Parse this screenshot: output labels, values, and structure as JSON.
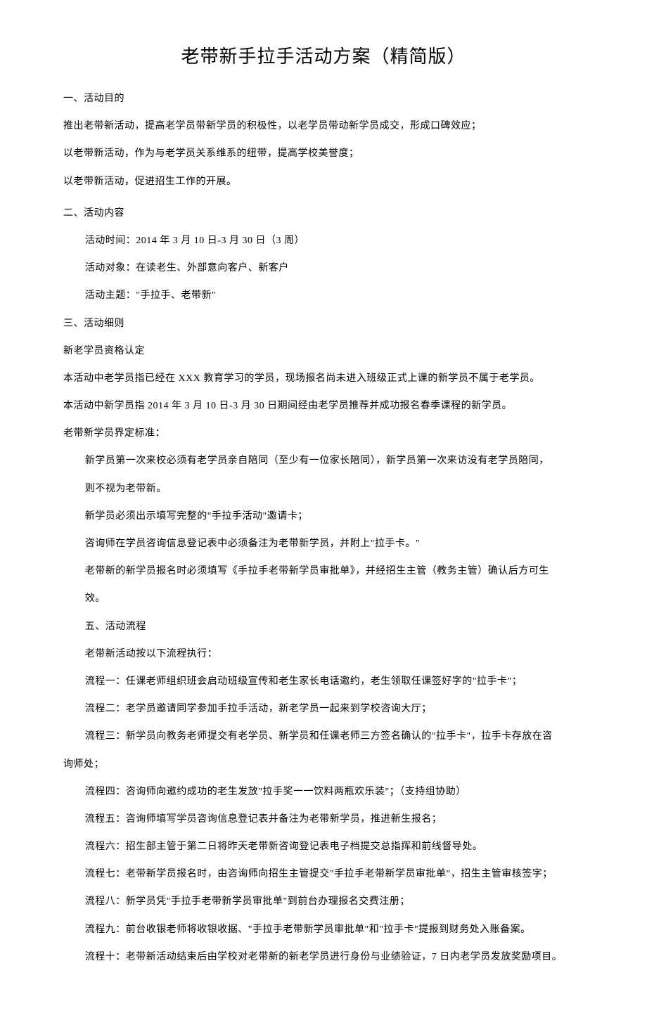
{
  "title": "老带新手拉手活动方案（精简版）",
  "section1": {
    "heading": "一、活动目的",
    "p1": "推出老带新活动，提高老学员带新学员的积极性，以老学员带动新学员成交，形成口碑效应；",
    "p2": "以老带新活动，作为与老学员关系维系的纽带，提高学校美誉度；",
    "p3": "以老带新活动，促进招生工作的开展。"
  },
  "section2": {
    "heading": "二、活动内容",
    "p1": "活动时间：2014 年 3 月 10 日-3 月 30 日（3 周）",
    "p2": "活动对象：在读老生、外部意向客户、新客户",
    "p3": "活动主题：\"手拉手、老带新\""
  },
  "section3": {
    "heading": "三、活动细则",
    "p1": "新老学员资格认定",
    "p2": "本活动中老学员指已经在 XXX 教育学习的学员，现场报名尚未进入班级正式上课的新学员不属于老学员。",
    "p3": "本活动中新学员指 2014 年 3 月 10 日-3 月 30 日期间经由老学员推荐并成功报名春季课程的新学员。",
    "p4": "老带新学员界定标准：",
    "p5a": "新学员第一次来校必须有老学员亲自陪同（至少有一位家长陪同），新学员第一次来访没有老学员陪同，",
    "p5b": "则不视为老带新。",
    "p6": "新学员必须出示填写完整的\"手拉手活动\"邀请卡；",
    "p7": "咨询师在学员咨询信息登记表中必须备注为老带新学员，并附上\"拉手卡。\"",
    "p8a": "老带新的新学员报名时必须填写《手拉手老带新学员审批单》，并经招生主管（教务主管）确认后方可生",
    "p8b": "效。"
  },
  "section5": {
    "heading": "五、活动流程",
    "intro": "老带新活动按以下流程执行：",
    "f1": "流程一：任课老师组织班会启动班级宣传和老生家长电话邀约，老生领取任课签好字的\"拉手卡\"；",
    "f2": "流程二：老学员邀请同学参加手拉手活动，新老学员一起来到学校咨询大厅；",
    "f3a": "流程三：新学员向教务老师提交有老学员、新学员和任课老师三方签名确认的\"拉手卡\"，拉手卡存放在咨",
    "f3b": "询师处；",
    "f4": "流程四：咨询师向邀约成功的老生发放\"拉手奖一一饮料两瓶欢乐装\"；（支持组协助）",
    "f5": "流程五：咨询师填写学员咨询信息登记表并备注为老带新学员，推进新生报名；",
    "f6": "流程六：招生部主管于第二日将昨天老带新咨询登记表电子档提交总指挥和前线督导处。",
    "f7": "流程七：老带新学员报名时，由咨询师向招生主管提交\"手拉手老带新学员审批单\"，招生主管审核签字；",
    "f8": "流程八：新学员凭\"手拉手老带新学员审批单\"到前台办理报名交费注册；",
    "f9": "流程九：前台收银老师将收银收据、\"手拉手老带新学员审批单\"和\"拉手卡\"提报到财务处入账备案。",
    "f10": "流程十：老带新活动结束后由学校对老带新的新老学员进行身份与业绩验证，7 日内老学员发放奖励项目。"
  }
}
